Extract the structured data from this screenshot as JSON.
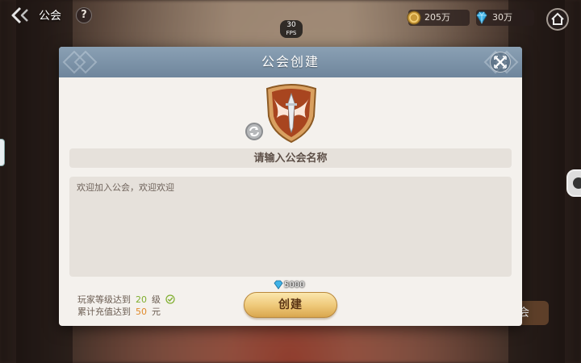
{
  "topbar": {
    "title": "公会",
    "help_symbol": "?",
    "fps_value": "30",
    "fps_label": "FPS",
    "gold_amount": "205万",
    "gem_amount": "30万"
  },
  "background": {
    "peek_label": "会"
  },
  "dialog": {
    "title": "公会创建",
    "name_placeholder": "请输入公会名称",
    "notice_text": "欢迎加入公会，欢迎欢迎",
    "requirements": [
      {
        "prefix": "玩家等级达到",
        "value": "20",
        "unit": "级",
        "met": true
      },
      {
        "prefix": "累计充值达到",
        "value": "50",
        "unit": "元",
        "met": false
      }
    ],
    "cost_amount": "5000",
    "create_label": "创建"
  },
  "icons": {
    "back": "back-arrow-icon",
    "help": "question-icon",
    "gold": "gold-coin-icon",
    "gem": "diamond-icon",
    "home": "home-icon",
    "close": "close-icon",
    "emblem": "guild-emblem-icon",
    "refresh": "refresh-icon",
    "check": "check-circle-icon"
  },
  "colors": {
    "header": "#7b91a6",
    "panel": "#f4f1ed",
    "field": "#e6e1db",
    "button_gold": "#eec777",
    "value_green": "#7fae2e",
    "value_orange": "#e08a2a"
  }
}
